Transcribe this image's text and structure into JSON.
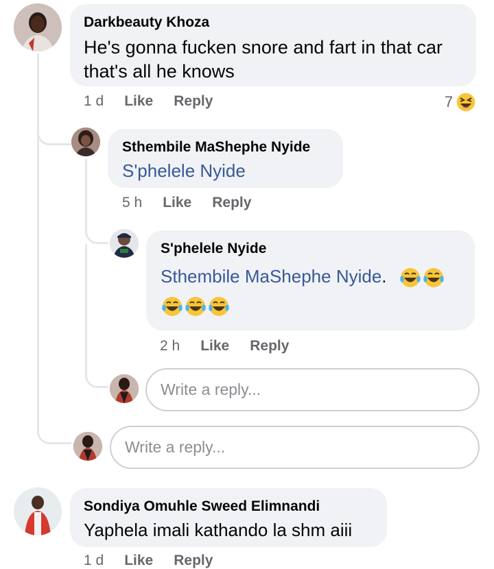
{
  "comments": [
    {
      "author": "Darkbeauty Khoza",
      "text_line1": "He's gonna fucken snore and fart in that car",
      "text_line2": "that's all he knows",
      "time": "1 d",
      "like": "Like",
      "reply": "Reply",
      "reaction_count": "7",
      "reaction_icon": "laughing-squint-emoji"
    },
    {
      "author": "Sthembile MaShephe Nyide",
      "mention": "S'phelele Nyide",
      "time": "5 h",
      "like": "Like",
      "reply": "Reply"
    },
    {
      "author": "S'phelele Nyide",
      "mention": "Sthembile MaShephe Nyide",
      "suffix": ".",
      "emoji_icon": "tears-of-joy-emoji",
      "time": "2 h",
      "like": "Like",
      "reply": "Reply"
    },
    {
      "author": "Sondiya Omuhle Sweed Elimnandi",
      "text": "Yaphela imali kathando la shm aiii",
      "time": "1 d",
      "like": "Like",
      "reply": "Reply"
    }
  ],
  "reply_inputs": [
    {
      "placeholder": "Write a reply..."
    },
    {
      "placeholder": "Write a reply..."
    }
  ],
  "colors": {
    "bubble": "#f0f2f5",
    "mention": "#385898",
    "meta": "#65676b",
    "thread_line": "#e4e6eb"
  }
}
